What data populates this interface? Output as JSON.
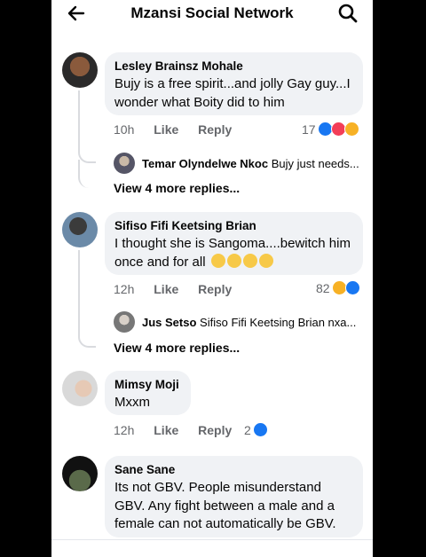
{
  "header": {
    "title": "Mzansi Social Network",
    "back_icon": "arrow-left-icon",
    "search_icon": "search-icon"
  },
  "comments": [
    {
      "author": "Lesley Brainsz Mohale",
      "text": "Bujy is a free spirit...and jolly Gay guy...I wonder what Boity did to him",
      "time": "10h",
      "like_label": "Like",
      "reply_label": "Reply",
      "reaction_count": "17",
      "reactions": [
        "like",
        "love",
        "wow"
      ],
      "reply_preview": {
        "author": "Temar Olyndelwe Nkoc",
        "text": "Bujy just needs..."
      },
      "more_replies": "View 4 more replies..."
    },
    {
      "author": "Sifiso Fifi Keetsing Brian",
      "text": "I thought she is Sangoma....bewitch him once and for all",
      "emojis": [
        "rolling-eyes",
        "rolling-eyes",
        "rolling-eyes",
        "rolling-eyes"
      ],
      "time": "12h",
      "like_label": "Like",
      "reply_label": "Reply",
      "reaction_count": "82",
      "reactions": [
        "haha",
        "like"
      ],
      "reply_preview": {
        "author": "Jus Setso",
        "text": "Sifiso Fifi Keetsing Brian nxa..."
      },
      "more_replies": "View 4 more replies..."
    },
    {
      "author": "Mimsy Moji",
      "text": "Mxxm",
      "time": "12h",
      "like_label": "Like",
      "reply_label": "Reply",
      "reaction_count": "2",
      "reactions": [
        "like"
      ]
    },
    {
      "author": "Sane Sane",
      "text": "Its not GBV. People misunderstand GBV. Any fight between a male and a female can not automatically be GBV."
    }
  ],
  "colors": {
    "like": "#1877f2",
    "love": "#f33e58",
    "wow": "#f7b125",
    "bubble": "#f0f2f5",
    "muted": "#65676b"
  }
}
